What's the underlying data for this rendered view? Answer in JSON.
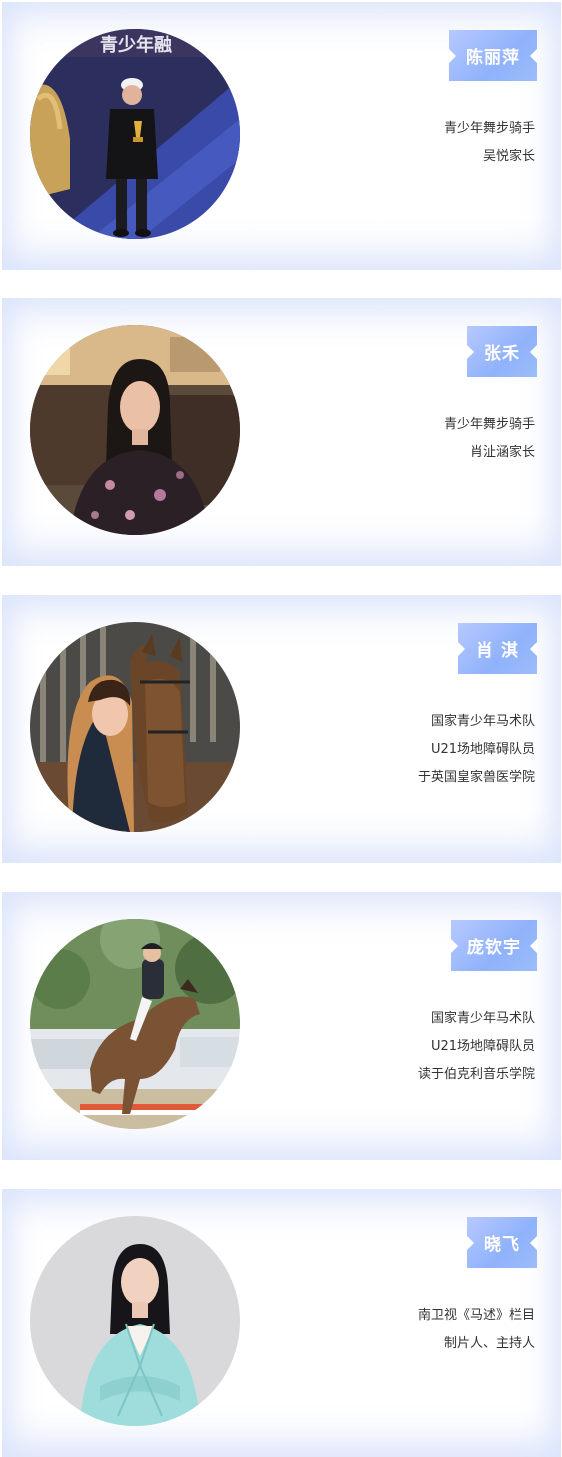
{
  "profiles": [
    {
      "name": "陈丽萍",
      "lines": [
        "青少年舞步骑手",
        "吴悦家长"
      ],
      "photo": "person-with-trophy-photo",
      "photo_text": "青少年融"
    },
    {
      "name": "张禾",
      "lines": [
        "青少年舞步骑手",
        "肖沚涵家长"
      ],
      "photo": "woman-portrait-photo"
    },
    {
      "name": "肖 淇",
      "lines": [
        "国家青少年马术队",
        "U21场地障碍队员",
        "于英国皇家兽医学院"
      ],
      "photo": "woman-with-horse-photo"
    },
    {
      "name": "庞钦宇",
      "lines": [
        "国家青少年马术队",
        "U21场地障碍队员",
        "读于伯克利音乐学院"
      ],
      "photo": "rider-jumping-horse-photo"
    },
    {
      "name": "晓飞",
      "lines": [
        "南卫视《马述》栏目",
        "制片人、主持人"
      ],
      "photo": "host-portrait-photo"
    }
  ],
  "colors": {
    "tag_gradient_start": "#b7c9ff",
    "tag_gradient_end": "#8fb2fb",
    "text": "#333333"
  }
}
